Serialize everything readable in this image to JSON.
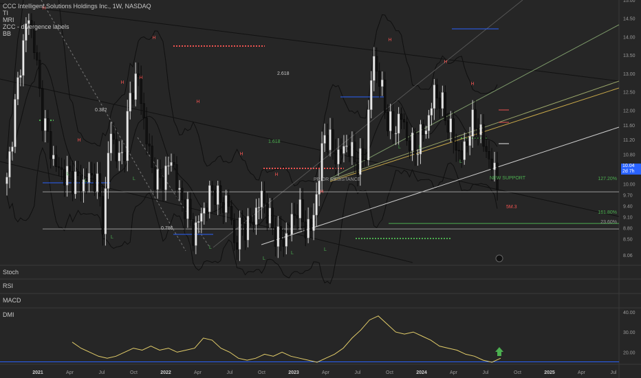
{
  "legend": {
    "title": "CCC Intelligent Solutions Holdings Inc., 1W, NASDAQ",
    "indicators": [
      "TI",
      "MRI",
      "ZCC - divergence labels",
      "BB"
    ]
  },
  "panes": {
    "stoch": "Stoch",
    "rsi": "RSI",
    "macd": "MACD",
    "dmi": "DMI"
  },
  "price_tag": {
    "value": "10.04",
    "sub": "2d 7h"
  },
  "annotations": {
    "prior_resistance": "PRIOR RESISTANCE",
    "new_support": "NEW SUPPORT",
    "target": "5M.3",
    "fib_0382": "0.382",
    "fib_0786": "0.786",
    "fib_2618": "2.618",
    "fib_1618": "1.618",
    "fib_1272": "127.20%",
    "fib_16180": "161.80%",
    "fib_2360": "23.60%"
  },
  "chart_data": [
    {
      "type": "candlestick",
      "title": "CCC Intelligent Solutions Holdings Inc., 1W, NASDAQ",
      "x_ticks": [
        "2021",
        "Apr",
        "Jul",
        "Oct",
        "2022",
        "Apr",
        "Jul",
        "Oct",
        "2023",
        "Apr",
        "Jul",
        "Oct",
        "2024",
        "Apr",
        "Jul",
        "Oct",
        "2025",
        "Apr",
        "Jul"
      ],
      "y_ticks": [
        15.0,
        14.5,
        14.0,
        13.5,
        13.0,
        12.5,
        12.0,
        11.6,
        11.2,
        10.8,
        10.4,
        10.0,
        9.7,
        9.4,
        9.1,
        8.8,
        8.5,
        8.06
      ],
      "ylim": [
        7.8,
        15.0
      ],
      "last_price": 10.04,
      "close_path": [
        10.0,
        11.8,
        13.3,
        14.6,
        13.8,
        12.0,
        11.2,
        10.5,
        10.3,
        10.2,
        10.1,
        10.0,
        10.2,
        10.1,
        8.9,
        11.6,
        10.6,
        10.9,
        12.6,
        12.9,
        11.5,
        10.4,
        10.0,
        10.3,
        10.7,
        9.6,
        9.4,
        8.6,
        9.1,
        9.5,
        9.9,
        9.4,
        9.6,
        8.3,
        8.9,
        8.8,
        9.2,
        9.7,
        9.0,
        8.6,
        8.4,
        8.8,
        9.4,
        8.9,
        8.7,
        9.9,
        11.4,
        11.0,
        10.7,
        11.1,
        10.8,
        10.5,
        10.9,
        13.5,
        12.8,
        11.8,
        11.4,
        11.9,
        11.2,
        10.9,
        11.3,
        11.7,
        12.6,
        12.1,
        11.6,
        11.0,
        10.7,
        11.5,
        11.7,
        11.1,
        10.6,
        10.04
      ],
      "levels": [
        {
          "label": "127.20%",
          "value": 9.78
        },
        {
          "label": "161.80%",
          "value": 8.92
        },
        {
          "label": "23.60%",
          "value": 8.77
        },
        {
          "label": "NEW SUPPORT",
          "value": 9.8
        },
        {
          "label": "PRIOR RESISTANCE",
          "value": 9.8
        }
      ]
    },
    {
      "type": "line",
      "title": "DMI",
      "y_ticks": [
        40.0,
        30.0,
        20.0
      ],
      "ylim": [
        14,
        42
      ],
      "values": [
        25,
        22,
        20,
        18,
        17,
        18,
        20,
        22,
        21,
        23,
        21,
        22,
        20,
        21,
        22,
        27,
        26,
        22,
        20,
        17,
        16,
        17,
        19,
        18,
        20,
        18,
        17,
        16,
        15,
        17,
        19,
        22,
        27,
        31,
        36,
        38,
        34,
        30,
        29,
        30,
        28,
        26,
        23,
        22,
        21,
        19,
        18,
        16,
        15,
        17
      ],
      "reference": 15.2
    }
  ]
}
